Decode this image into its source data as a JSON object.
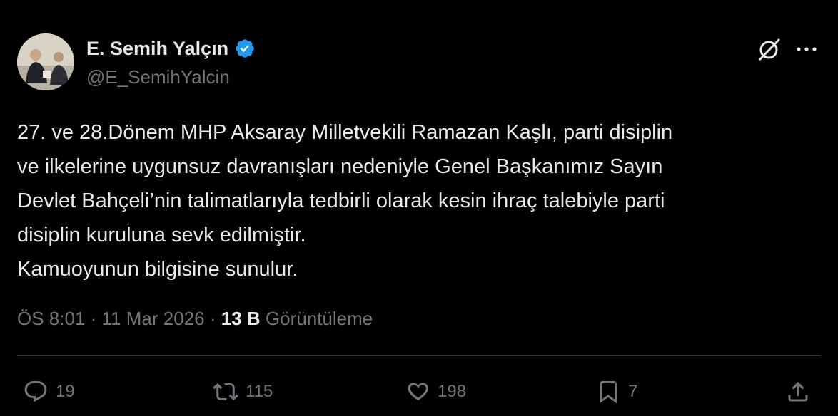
{
  "author": {
    "display_name": "E. Semih Yalçın",
    "handle": "@E_SemihYalcin",
    "verified": true,
    "verified_color": "#1d9bf0"
  },
  "tweet": {
    "text": "27. ve 28.Dönem MHP Aksaray Milletvekili Ramazan Kaşlı, parti disiplin\nve ilkelerine uygunsuz davranışları nedeniyle Genel Başkanımız Sayın\nDevlet Bahçeli’nin talimatlarıyla tedbirli olarak kesin ihraç talebiyle parti\ndisiplin kuruluna sevk edilmiştir.\nKamuoyunun bilgisine sunulur."
  },
  "meta": {
    "time": "ÖS 8:01",
    "separator": "·",
    "date": "11 Mar 2026",
    "views_count": "13 B",
    "views_label": "Görüntüleme"
  },
  "actions": {
    "replies": "19",
    "reposts": "115",
    "likes": "198",
    "bookmarks": "7"
  },
  "icons": {
    "grok": "grok-icon",
    "more": "more-icon",
    "reply": "reply-icon",
    "repost": "repost-icon",
    "like": "heart-icon",
    "bookmark": "bookmark-icon",
    "share": "share-icon"
  }
}
